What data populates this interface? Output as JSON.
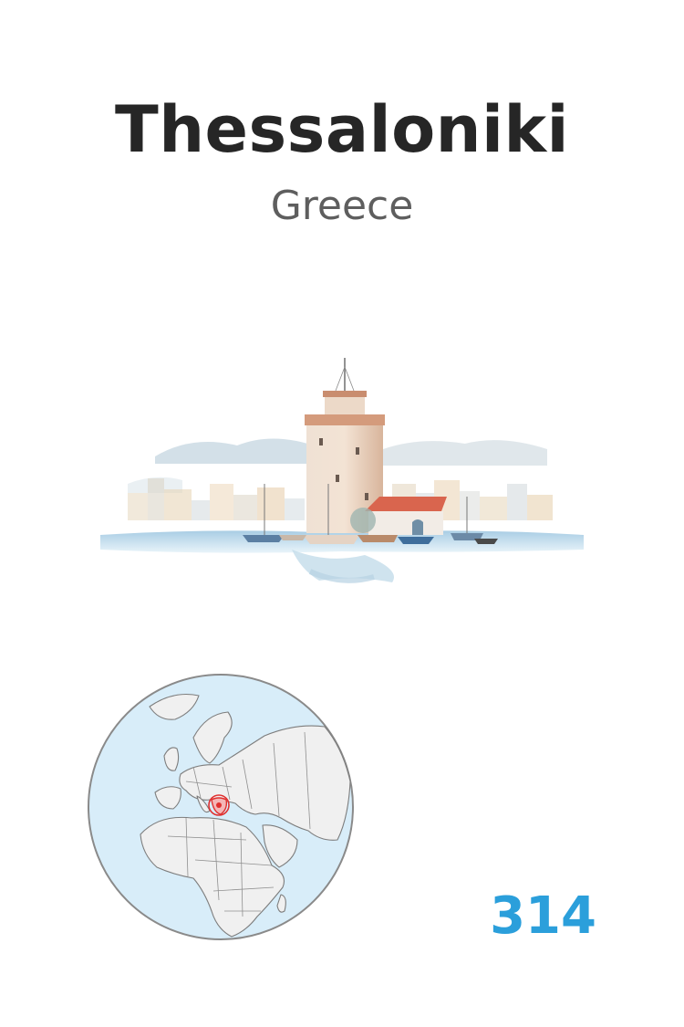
{
  "card": {
    "city": "Thessaloniki",
    "country": "Greece",
    "number": "314"
  },
  "illustration": {
    "subject": "white-tower-watercolor",
    "colors": {
      "tower": "#e9d2bf",
      "roof": "#d9654e",
      "sea": "#bcd9ea",
      "skyline": "#e8d7b8"
    }
  },
  "globe": {
    "icon": "globe-locator-map",
    "colors": {
      "ocean": "#d8edf9",
      "land": "#f0f0f0",
      "border": "#7d7d7d",
      "highlight": "#e0302f"
    }
  },
  "colors": {
    "title": "#262626",
    "subtitle": "#5e5e5e",
    "number": "#2b9fdb"
  }
}
